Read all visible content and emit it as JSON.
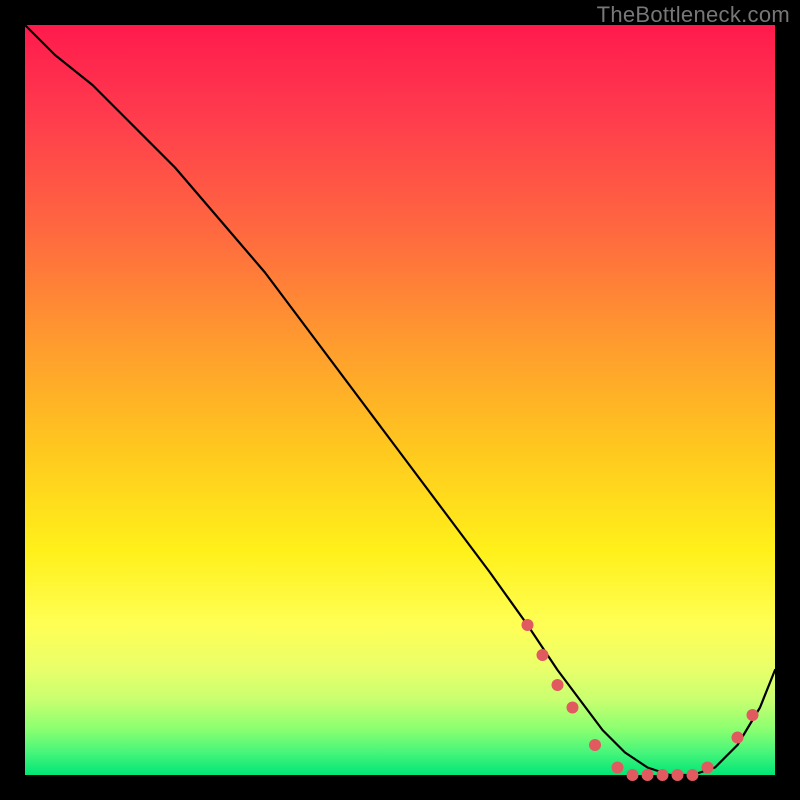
{
  "watermark": "TheBottleneck.com",
  "colors": {
    "page_bg": "#000000",
    "curve": "#000000",
    "dots": "#e05a60",
    "gradient_top": "#ff1a4d",
    "gradient_bottom": "#00e676"
  },
  "chart_data": {
    "type": "line",
    "title": "",
    "xlabel": "",
    "ylabel": "",
    "xlim": [
      0,
      100
    ],
    "ylim": [
      0,
      100
    ],
    "grid": false,
    "legend": false,
    "series": [
      {
        "name": "curve",
        "x": [
          0,
          4,
          9,
          14,
          20,
          26,
          32,
          38,
          44,
          50,
          56,
          62,
          67,
          71,
          74,
          77,
          80,
          83,
          86,
          89,
          92,
          95,
          98,
          100
        ],
        "y": [
          100,
          96,
          92,
          87,
          81,
          74,
          67,
          59,
          51,
          43,
          35,
          27,
          20,
          14,
          10,
          6,
          3,
          1,
          0,
          0,
          1,
          4,
          9,
          14
        ]
      }
    ],
    "markers": [
      {
        "x": 67,
        "y": 20
      },
      {
        "x": 69,
        "y": 16
      },
      {
        "x": 71,
        "y": 12
      },
      {
        "x": 73,
        "y": 9
      },
      {
        "x": 76,
        "y": 4
      },
      {
        "x": 79,
        "y": 1
      },
      {
        "x": 81,
        "y": 0
      },
      {
        "x": 83,
        "y": 0
      },
      {
        "x": 85,
        "y": 0
      },
      {
        "x": 87,
        "y": 0
      },
      {
        "x": 89,
        "y": 0
      },
      {
        "x": 91,
        "y": 1
      },
      {
        "x": 95,
        "y": 5
      },
      {
        "x": 97,
        "y": 8
      }
    ],
    "marker_radius": 6
  }
}
